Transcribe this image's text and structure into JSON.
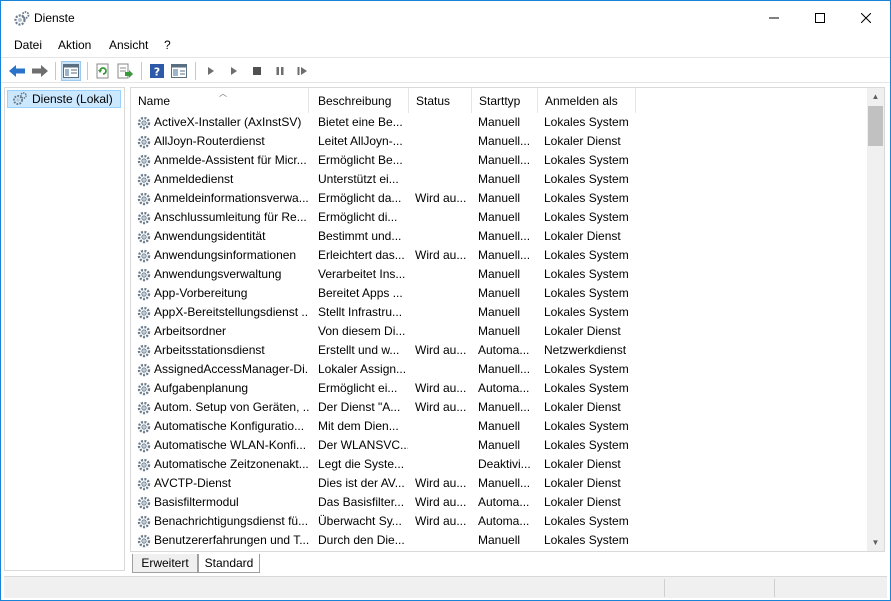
{
  "window": {
    "title": "Dienste",
    "icon": "gears-icon"
  },
  "menu": [
    {
      "label": "Datei"
    },
    {
      "label": "Aktion"
    },
    {
      "label": "Ansicht"
    },
    {
      "label": "?"
    }
  ],
  "toolbar": {
    "buttons": [
      "back-icon",
      "forward-icon",
      "show-hide-console-tree-icon",
      "refresh-icon",
      "export-list-icon",
      "help-icon",
      "properties-icon",
      "start-service-icon",
      "start-service-alt-icon",
      "stop-service-icon",
      "pause-service-icon",
      "restart-service-icon"
    ]
  },
  "tree": {
    "root_label": "Dienste (Lokal)"
  },
  "columns": {
    "name": "Name",
    "description": "Beschreibung",
    "status": "Status",
    "startup": "Starttyp",
    "logon": "Anmelden als"
  },
  "rows": [
    {
      "name": "ActiveX-Installer (AxInstSV)",
      "desc": "Bietet eine Be...",
      "status": "",
      "startup": "Manuell",
      "logon": "Lokales System"
    },
    {
      "name": "AllJoyn-Routerdienst",
      "desc": "Leitet AllJoyn-...",
      "status": "",
      "startup": "Manuell...",
      "logon": "Lokaler Dienst"
    },
    {
      "name": "Anmelde-Assistent für Micr...",
      "desc": "Ermöglicht Be...",
      "status": "",
      "startup": "Manuell...",
      "logon": "Lokales System"
    },
    {
      "name": "Anmeldedienst",
      "desc": "Unterstützt ei...",
      "status": "",
      "startup": "Manuell",
      "logon": "Lokales System"
    },
    {
      "name": "Anmeldeinformationsverwa...",
      "desc": "Ermöglicht da...",
      "status": "Wird au...",
      "startup": "Manuell",
      "logon": "Lokales System"
    },
    {
      "name": "Anschlussumleitung für Re...",
      "desc": "Ermöglicht di...",
      "status": "",
      "startup": "Manuell",
      "logon": "Lokales System"
    },
    {
      "name": "Anwendungsidentität",
      "desc": "Bestimmt und...",
      "status": "",
      "startup": "Manuell...",
      "logon": "Lokaler Dienst"
    },
    {
      "name": "Anwendungsinformationen",
      "desc": "Erleichtert das...",
      "status": "Wird au...",
      "startup": "Manuell...",
      "logon": "Lokales System"
    },
    {
      "name": "Anwendungsverwaltung",
      "desc": "Verarbeitet Ins...",
      "status": "",
      "startup": "Manuell",
      "logon": "Lokales System"
    },
    {
      "name": "App-Vorbereitung",
      "desc": "Bereitet Apps ...",
      "status": "",
      "startup": "Manuell",
      "logon": "Lokales System"
    },
    {
      "name": "AppX-Bereitstellungsdienst ...",
      "desc": "Stellt Infrastru...",
      "status": "",
      "startup": "Manuell",
      "logon": "Lokales System"
    },
    {
      "name": "Arbeitsordner",
      "desc": "Von diesem Di...",
      "status": "",
      "startup": "Manuell",
      "logon": "Lokaler Dienst"
    },
    {
      "name": "Arbeitsstationsdienst",
      "desc": "Erstellt und w...",
      "status": "Wird au...",
      "startup": "Automa...",
      "logon": "Netzwerkdienst"
    },
    {
      "name": "AssignedAccessManager-Di...",
      "desc": "Lokaler Assign...",
      "status": "",
      "startup": "Manuell...",
      "logon": "Lokales System"
    },
    {
      "name": "Aufgabenplanung",
      "desc": "Ermöglicht ei...",
      "status": "Wird au...",
      "startup": "Automa...",
      "logon": "Lokales System"
    },
    {
      "name": "Autom. Setup von Geräten, ...",
      "desc": "Der Dienst \"A...",
      "status": "Wird au...",
      "startup": "Manuell...",
      "logon": "Lokaler Dienst"
    },
    {
      "name": "Automatische Konfiguratio...",
      "desc": "Mit dem Dien...",
      "status": "",
      "startup": "Manuell",
      "logon": "Lokales System"
    },
    {
      "name": "Automatische WLAN-Konfi...",
      "desc": "Der WLANSVC...",
      "status": "",
      "startup": "Manuell",
      "logon": "Lokales System"
    },
    {
      "name": "Automatische Zeitzonenakt...",
      "desc": "Legt die Syste...",
      "status": "",
      "startup": "Deaktivi...",
      "logon": "Lokaler Dienst"
    },
    {
      "name": "AVCTP-Dienst",
      "desc": "Dies ist der AV...",
      "status": "Wird au...",
      "startup": "Manuell...",
      "logon": "Lokaler Dienst"
    },
    {
      "name": "Basisfiltermodul",
      "desc": "Das Basisfilter...",
      "status": "Wird au...",
      "startup": "Automa...",
      "logon": "Lokaler Dienst"
    },
    {
      "name": "Benachrichtigungsdienst fü...",
      "desc": "Überwacht Sy...",
      "status": "Wird au...",
      "startup": "Automa...",
      "logon": "Lokales System"
    },
    {
      "name": "Benutzererfahrungen und T...",
      "desc": "Durch den Die...",
      "status": "",
      "startup": "Manuell",
      "logon": "Lokales System"
    }
  ],
  "tabs": [
    {
      "label": "Erweitert",
      "active": false
    },
    {
      "label": "Standard",
      "active": true
    }
  ]
}
